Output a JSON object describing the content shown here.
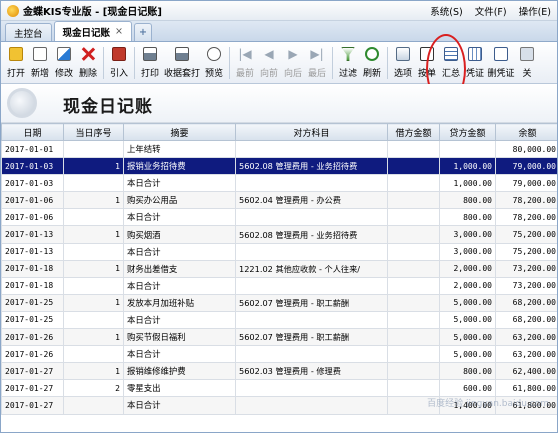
{
  "app": {
    "title": "金蝶KIS专业版 - [现金日记账]",
    "menu": [
      "系统(S)",
      "文件(F)",
      "操作(E)"
    ]
  },
  "tabs": [
    {
      "label": "主控台",
      "active": false
    },
    {
      "label": "现金日记账",
      "active": true,
      "close": "×"
    },
    {
      "label": "+",
      "active": false
    }
  ],
  "toolbar": {
    "buttons": [
      {
        "label": "打开",
        "icon": "open-folder-icon",
        "enabled": true
      },
      {
        "label": "新增",
        "icon": "new-document-icon",
        "enabled": true
      },
      {
        "label": "修改",
        "icon": "edit-icon",
        "enabled": true
      },
      {
        "label": "删除",
        "icon": "delete-x-icon",
        "enabled": true
      },
      {
        "label": "引入",
        "icon": "import-icon",
        "enabled": true
      },
      {
        "label": "打印",
        "icon": "printer-icon",
        "enabled": true
      },
      {
        "label": "收据套打",
        "icon": "receipt-print-icon",
        "enabled": true
      },
      {
        "label": "预览",
        "icon": "print-preview-icon",
        "enabled": true
      },
      {
        "label": "最前",
        "icon": "first-arrow-icon",
        "enabled": false
      },
      {
        "label": "向前",
        "icon": "prev-arrow-icon",
        "enabled": false
      },
      {
        "label": "向后",
        "icon": "next-arrow-icon",
        "enabled": false
      },
      {
        "label": "最后",
        "icon": "last-arrow-icon",
        "enabled": false
      },
      {
        "label": "过滤",
        "icon": "filter-icon",
        "enabled": true
      },
      {
        "label": "刷新",
        "icon": "refresh-icon",
        "enabled": true
      },
      {
        "label": "选项",
        "icon": "options-icon",
        "enabled": true
      },
      {
        "label": "按单",
        "icon": "by-voucher-icon",
        "enabled": true
      },
      {
        "label": "汇总",
        "icon": "summary-icon",
        "enabled": true
      },
      {
        "label": "凭证",
        "icon": "voucher-icon",
        "enabled": true
      },
      {
        "label": "删凭证",
        "icon": "delete-voucher-icon",
        "enabled": true
      },
      {
        "label": "关",
        "icon": "close-icon",
        "enabled": true
      }
    ]
  },
  "banner": {
    "title": "现金日记账"
  },
  "table": {
    "columns": [
      "日期",
      "当日序号",
      "摘要",
      "对方科目",
      "借方金额",
      "贷方金额",
      "余额"
    ],
    "rows": [
      {
        "date": "2017-01-01",
        "seq": "",
        "summary": "上年结转",
        "account": "",
        "debit": "",
        "credit": "",
        "balance": "80,000.00",
        "selected": false
      },
      {
        "date": "2017-01-03",
        "seq": "1",
        "summary": "报销业务招待费",
        "account": "5602.08 管理费用 - 业务招待费",
        "debit": "",
        "credit": "1,000.00",
        "balance": "79,000.00",
        "selected": true
      },
      {
        "date": "2017-01-03",
        "seq": "",
        "summary": "本日合计",
        "account": "",
        "debit": "",
        "credit": "1,000.00",
        "balance": "79,000.00",
        "selected": false
      },
      {
        "date": "2017-01-06",
        "seq": "1",
        "summary": "购买办公用品",
        "account": "5602.04 管理费用 - 办公费",
        "debit": "",
        "credit": "800.00",
        "balance": "78,200.00",
        "selected": false
      },
      {
        "date": "2017-01-06",
        "seq": "",
        "summary": "本日合计",
        "account": "",
        "debit": "",
        "credit": "800.00",
        "balance": "78,200.00",
        "selected": false
      },
      {
        "date": "2017-01-13",
        "seq": "1",
        "summary": "购买烟酒",
        "account": "5602.08 管理费用 - 业务招待费",
        "debit": "",
        "credit": "3,000.00",
        "balance": "75,200.00",
        "selected": false
      },
      {
        "date": "2017-01-13",
        "seq": "",
        "summary": "本日合计",
        "account": "",
        "debit": "",
        "credit": "3,000.00",
        "balance": "75,200.00",
        "selected": false
      },
      {
        "date": "2017-01-18",
        "seq": "1",
        "summary": "财务出差借支",
        "account": "1221.02 其他应收款 - 个人往来/",
        "debit": "",
        "credit": "2,000.00",
        "balance": "73,200.00",
        "selected": false
      },
      {
        "date": "2017-01-18",
        "seq": "",
        "summary": "本日合计",
        "account": "",
        "debit": "",
        "credit": "2,000.00",
        "balance": "73,200.00",
        "selected": false
      },
      {
        "date": "2017-01-25",
        "seq": "1",
        "summary": "发放本月加班补贴",
        "account": "5602.07 管理费用 - 职工薪酬",
        "debit": "",
        "credit": "5,000.00",
        "balance": "68,200.00",
        "selected": false
      },
      {
        "date": "2017-01-25",
        "seq": "",
        "summary": "本日合计",
        "account": "",
        "debit": "",
        "credit": "5,000.00",
        "balance": "68,200.00",
        "selected": false
      },
      {
        "date": "2017-01-26",
        "seq": "1",
        "summary": "购买节假日福利",
        "account": "5602.07 管理费用 - 职工薪酬",
        "debit": "",
        "credit": "5,000.00",
        "balance": "63,200.00",
        "selected": false
      },
      {
        "date": "2017-01-26",
        "seq": "",
        "summary": "本日合计",
        "account": "",
        "debit": "",
        "credit": "5,000.00",
        "balance": "63,200.00",
        "selected": false
      },
      {
        "date": "2017-01-27",
        "seq": "1",
        "summary": "报销维修维护费",
        "account": "5602.03 管理费用 - 修理费",
        "debit": "",
        "credit": "800.00",
        "balance": "62,400.00",
        "selected": false
      },
      {
        "date": "2017-01-27",
        "seq": "2",
        "summary": "零星支出",
        "account": "",
        "debit": "",
        "credit": "600.00",
        "balance": "61,800.00",
        "selected": false
      },
      {
        "date": "2017-01-27",
        "seq": "",
        "summary": "本日合计",
        "account": "",
        "debit": "",
        "credit": "1,400.00",
        "balance": "61,800.00",
        "selected": false
      }
    ]
  },
  "watermark": "百度经验 jingyan.baidu.com",
  "colors": {
    "selected_row": "#0f1b7f",
    "annotation": "#d92020",
    "header_bg": "#d7e1ec"
  }
}
